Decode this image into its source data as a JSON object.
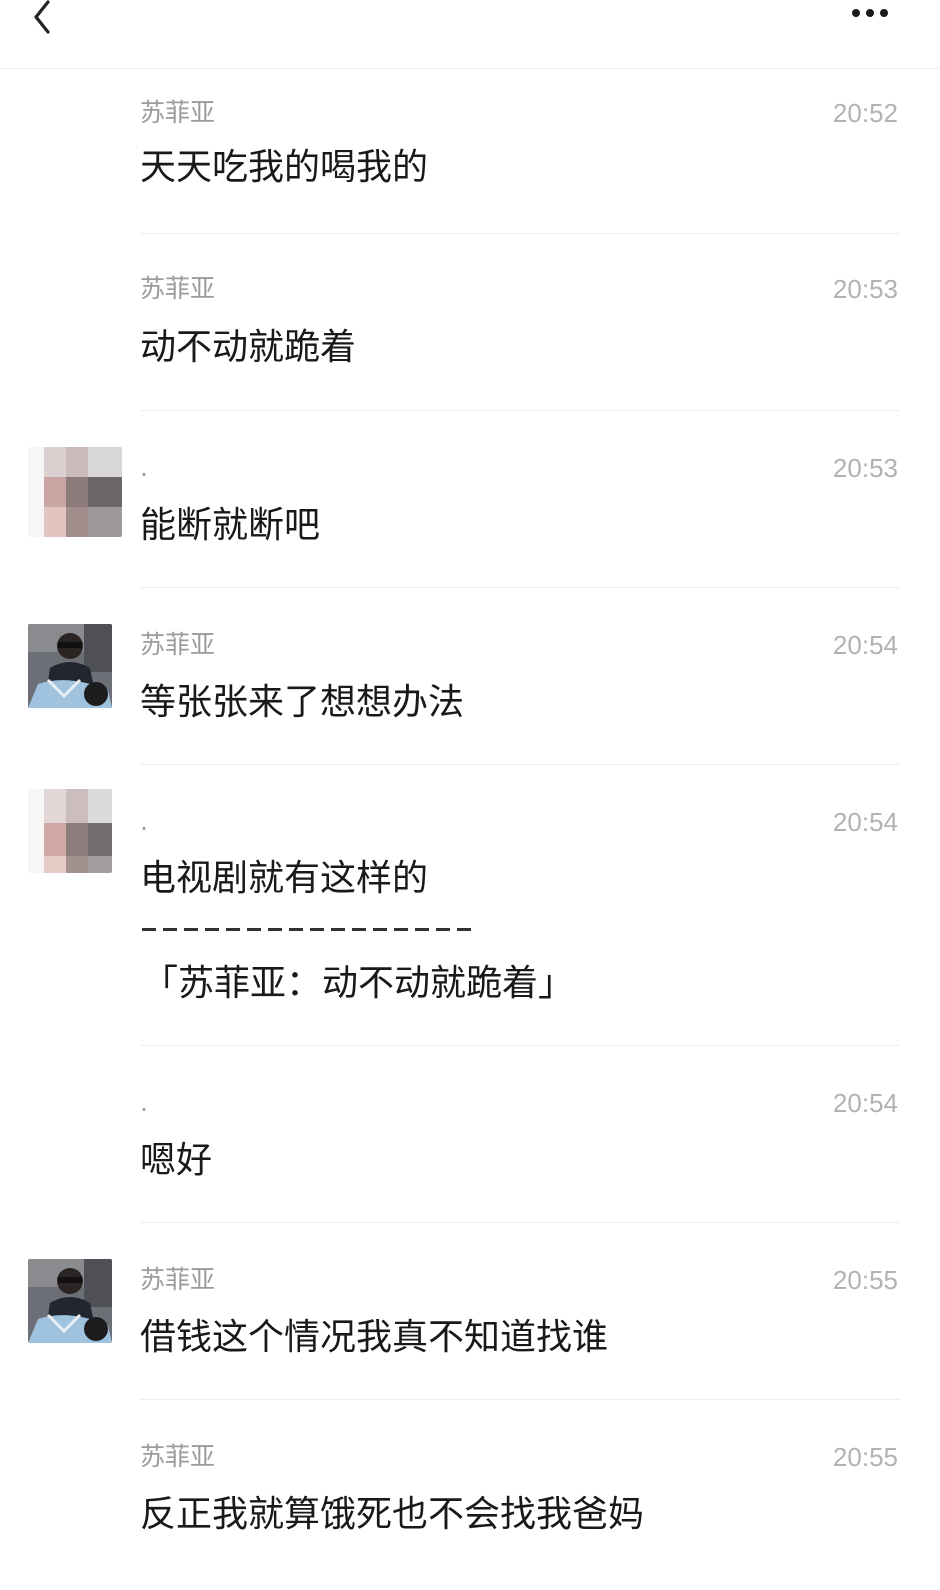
{
  "header": {
    "back_icon": "chevron-left-icon",
    "more_icon": "more-dots-icon"
  },
  "messages": [
    {
      "sender": "苏菲亚",
      "time": "20:52",
      "text": "天天吃我的喝我的",
      "avatar": "none"
    },
    {
      "sender": "苏菲亚",
      "time": "20:53",
      "text": "动不动就跪着",
      "avatar": "none"
    },
    {
      "sender": ".",
      "time": "20:53",
      "text": "能断就断吧",
      "avatar": "blurred-avatar"
    },
    {
      "sender": "苏菲亚",
      "time": "20:54",
      "text": "等张张来了想想办法",
      "avatar": "photo-avatar"
    },
    {
      "sender": ".",
      "time": "20:54",
      "text": "电视剧就有这样的",
      "avatar": "blurred-avatar",
      "quote": "「苏菲亚：动不动就跪着」"
    },
    {
      "sender": ".",
      "time": "20:54",
      "text": "嗯好",
      "avatar": "none"
    },
    {
      "sender": "苏菲亚",
      "time": "20:55",
      "text": "借钱这个情况我真不知道找谁",
      "avatar": "photo-avatar"
    },
    {
      "sender": "苏菲亚",
      "time": "20:55",
      "text": "反正我就算饿死也不会找我爸妈",
      "avatar": "none"
    }
  ],
  "colors": {
    "sender": "#9b9b9b",
    "time": "#b2b2b2",
    "text": "#191919",
    "divider": "#ededed"
  }
}
